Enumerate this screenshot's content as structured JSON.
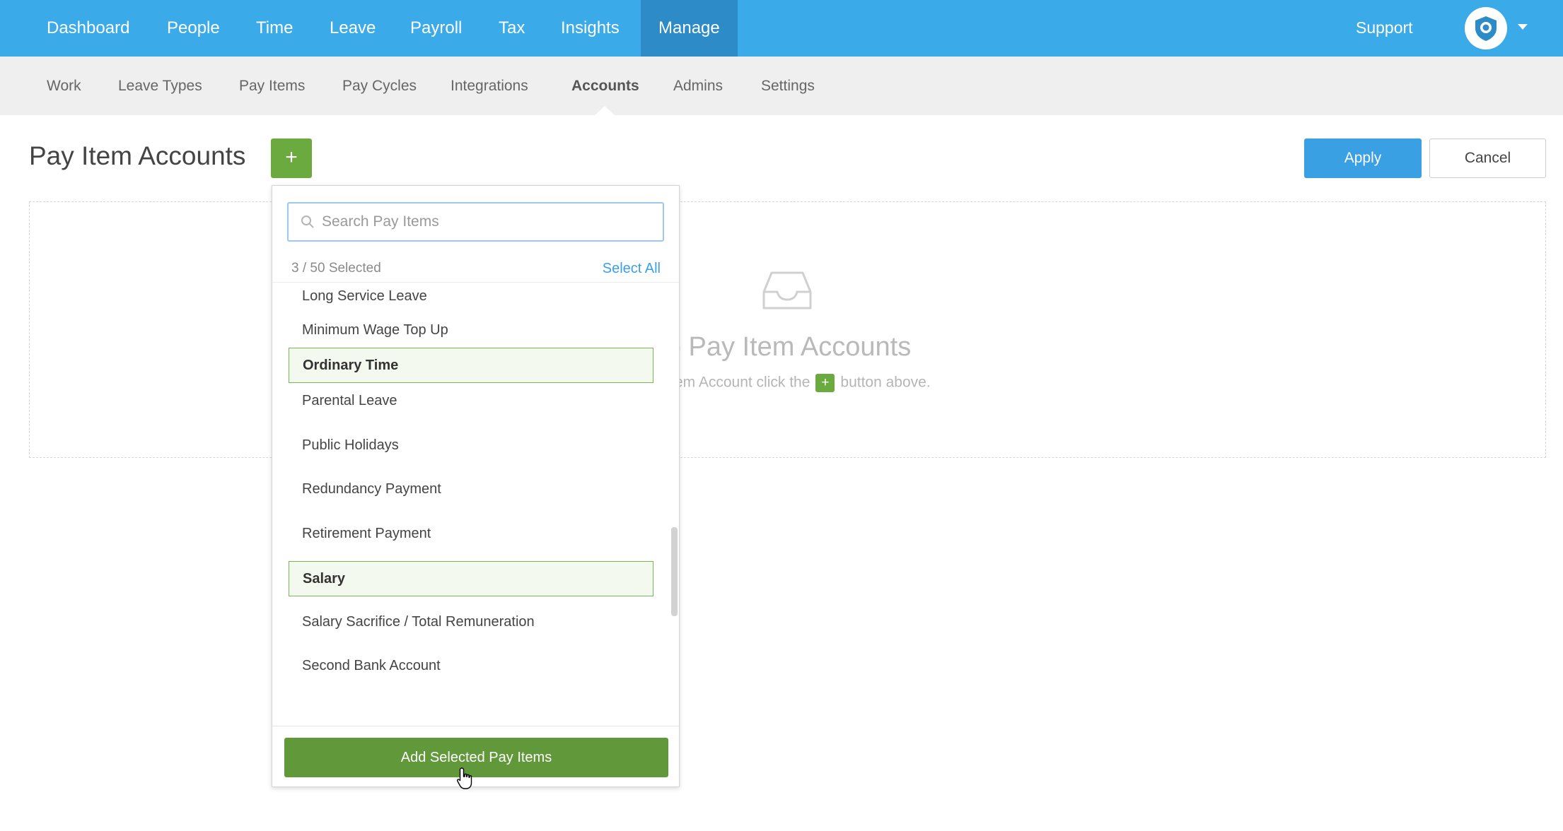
{
  "topnav": {
    "items": [
      "Dashboard",
      "People",
      "Time",
      "Leave",
      "Payroll",
      "Tax",
      "Insights",
      "Manage"
    ],
    "active": "Manage",
    "support": "Support",
    "accent": "#3aabe8"
  },
  "subnav": {
    "items": [
      "Work",
      "Leave Types",
      "Pay Items",
      "Pay Cycles",
      "Integrations",
      "Accounts",
      "Admins",
      "Settings"
    ],
    "active": "Accounts"
  },
  "page": {
    "title": "Pay Item Accounts",
    "add_label": "+",
    "apply_label": "Apply",
    "cancel_label": "Cancel"
  },
  "empty_state": {
    "title": "o Pay Item Accounts",
    "sub_before": "ay Item Account click the",
    "plus": "+",
    "sub_after": "button above."
  },
  "dropdown": {
    "search_placeholder": "Search Pay Items",
    "count_text": "3 / 50 Selected",
    "select_all": "Select All",
    "items": [
      {
        "label": "Long Service Leave",
        "selected": false
      },
      {
        "label": "Minimum Wage Top Up",
        "selected": false
      },
      {
        "label": "Ordinary Time",
        "selected": true
      },
      {
        "label": "Parental Leave",
        "selected": false
      },
      {
        "label": "Public Holidays",
        "selected": false
      },
      {
        "label": "Redundancy Payment",
        "selected": false
      },
      {
        "label": "Retirement Payment",
        "selected": false
      },
      {
        "label": "Salary",
        "selected": true
      },
      {
        "label": "Salary Sacrifice / Total Remuneration",
        "selected": false
      },
      {
        "label": "Second Bank Account",
        "selected": false
      }
    ],
    "add_button": "Add Selected Pay Items"
  },
  "colors": {
    "primary_blue": "#3aa0e4",
    "green": "#6aaa3e",
    "selected_bg": "#f4f9ef"
  }
}
